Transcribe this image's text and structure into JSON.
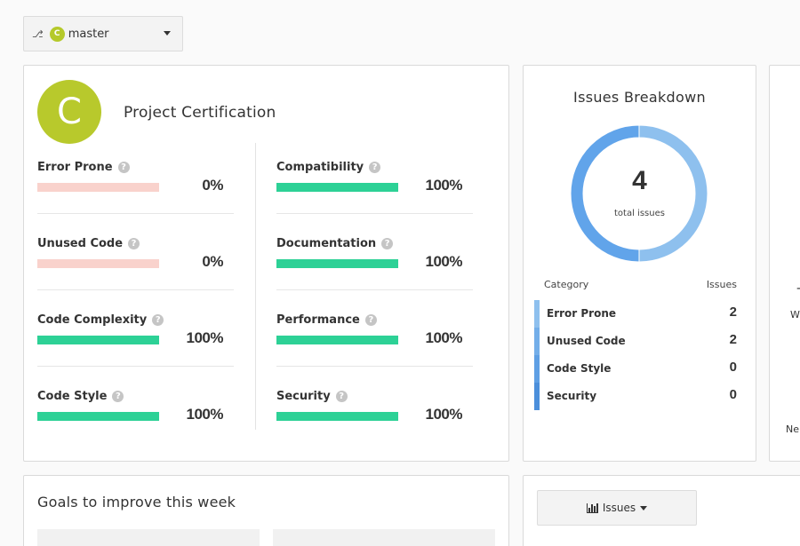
{
  "branch": {
    "icon": "branch-icon",
    "grade": "C",
    "name": "master"
  },
  "certification": {
    "grade": "C",
    "title": "Project Certification",
    "metrics_left": [
      {
        "label": "Error Prone",
        "value": "0%",
        "fraction": 0
      },
      {
        "label": "Unused Code",
        "value": "0%",
        "fraction": 0
      },
      {
        "label": "Code Complexity",
        "value": "100%",
        "fraction": 1
      },
      {
        "label": "Code Style",
        "value": "100%",
        "fraction": 1
      }
    ],
    "metrics_right": [
      {
        "label": "Compatibility",
        "value": "100%",
        "fraction": 1
      },
      {
        "label": "Documentation",
        "value": "100%",
        "fraction": 1
      },
      {
        "label": "Performance",
        "value": "100%",
        "fraction": 1
      },
      {
        "label": "Security",
        "value": "100%",
        "fraction": 1
      }
    ],
    "colors": {
      "bar_fill": "#2dd196",
      "bar_empty": "#f9d2cc",
      "grade_badge": "#b8c92c"
    }
  },
  "issues": {
    "title": "Issues Breakdown",
    "total": "4",
    "total_label": "total issues",
    "col_category": "Category",
    "col_issues": "Issues",
    "rows": [
      {
        "label": "Error Prone",
        "count": "2",
        "color": "#8ec0ee"
      },
      {
        "label": "Unused Code",
        "count": "2",
        "color": "#73aee9"
      },
      {
        "label": "Code Style",
        "count": "0",
        "color": "#5e9fe4"
      },
      {
        "label": "Security",
        "count": "0",
        "color": "#4b8fdb"
      }
    ],
    "donut_segments": [
      {
        "category": "Error Prone",
        "value": 2,
        "color": "#8ec0ee"
      },
      {
        "category": "Unused Code",
        "value": 2,
        "color": "#61a4ea"
      }
    ]
  },
  "partial_card": {
    "dash": "-",
    "w": "W",
    "ne": "Ne"
  },
  "goals": {
    "title": "Goals to improve this week"
  },
  "bottom_dropdown": {
    "icon": "bar-chart-icon",
    "label": "Issues"
  }
}
